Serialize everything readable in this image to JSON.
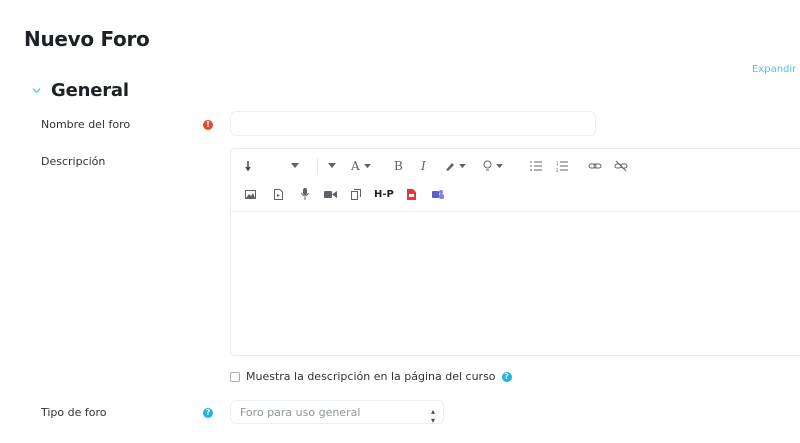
{
  "page": {
    "title": "Nuevo Foro",
    "expand_link": "Expandir"
  },
  "section": {
    "title": "General"
  },
  "fields": {
    "forum_name": {
      "label": "Nombre del foro",
      "value": "",
      "required": true
    },
    "description": {
      "label": "Descripción"
    },
    "show_description": {
      "label": "Muestra la descripción en la página del curso",
      "checked": false
    },
    "forum_type": {
      "label": "Tipo de foro",
      "selected": "Foro para uso general"
    }
  },
  "editor": {
    "toolbar_row1": [
      "paragraph-style-icon",
      "dropdown-caret-icon",
      "dropdown-caret-icon",
      "font-color-icon",
      "bold-icon",
      "italic-icon",
      "highlighter-icon",
      "lightbulb-icon",
      "unordered-list-icon",
      "ordered-list-icon",
      "link-icon",
      "unlink-icon"
    ],
    "toolbar_row2": [
      "image-icon",
      "media-file-icon",
      "microphone-icon",
      "video-camera-icon",
      "copy-icon",
      "h5p-icon",
      "pdf-icon",
      "teams-icon"
    ],
    "labels": {
      "bold": "B",
      "italic": "I",
      "font": "A",
      "h5p": "H-P"
    }
  },
  "colors": {
    "required": "#e44a2f",
    "help": "#20b4e0",
    "link": "#52c3e6",
    "text": "#1d2125"
  }
}
